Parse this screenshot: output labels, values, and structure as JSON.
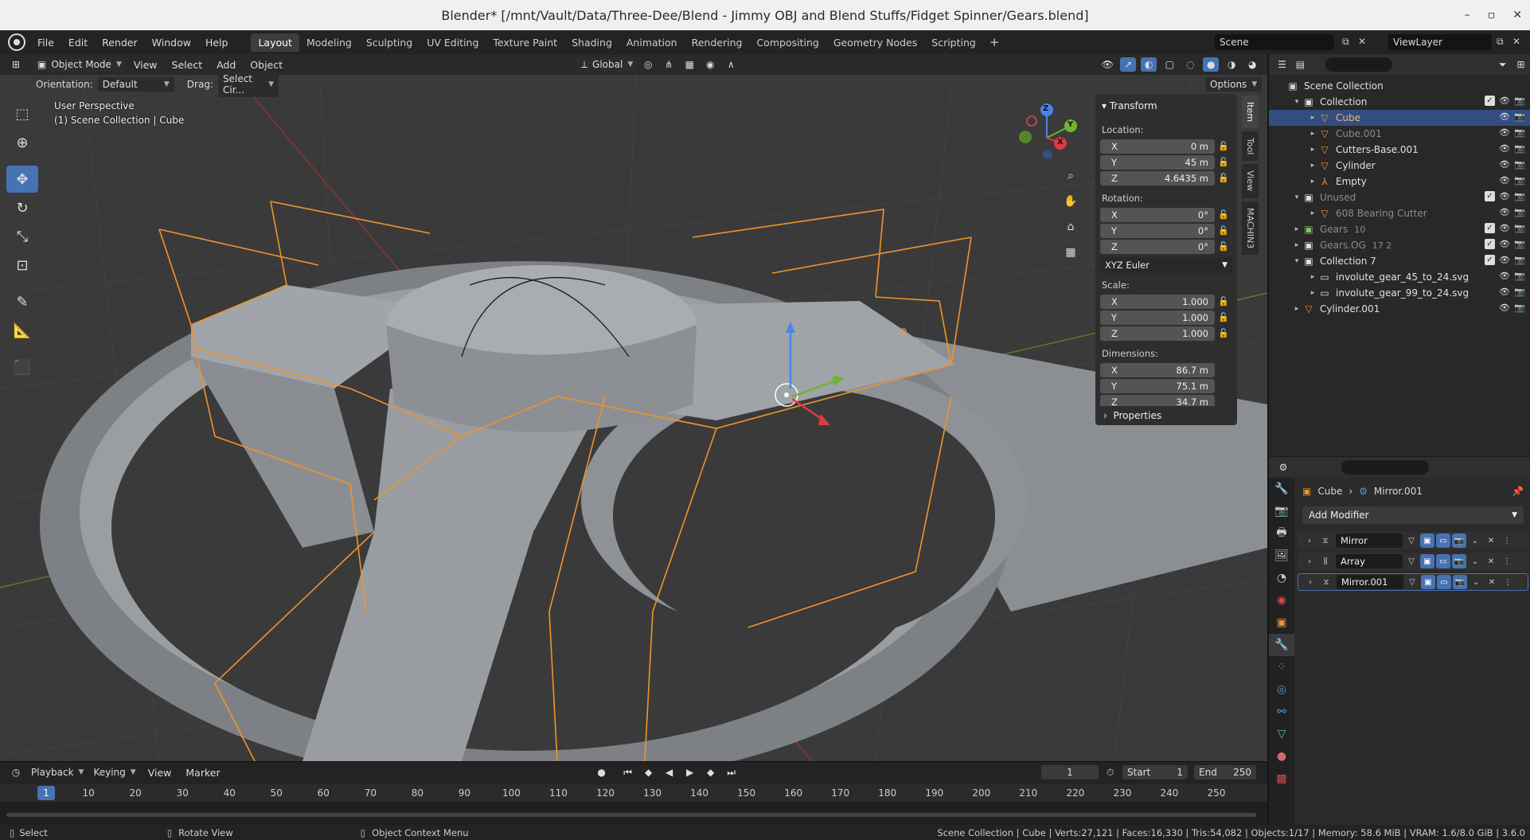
{
  "window": {
    "title": "Blender* [/mnt/Vault/Data/Three-Dee/Blend - Jimmy OBJ and Blend Stuffs/Fidget Spinner/Gears.blend]"
  },
  "menu": [
    "File",
    "Edit",
    "Render",
    "Window",
    "Help"
  ],
  "workspaces": [
    "Layout",
    "Modeling",
    "Sculpting",
    "UV Editing",
    "Texture Paint",
    "Shading",
    "Animation",
    "Rendering",
    "Compositing",
    "Geometry Nodes",
    "Scripting"
  ],
  "active_workspace": "Layout",
  "scene": "Scene",
  "view_layer": "ViewLayer",
  "viewport": {
    "mode": "Object Mode",
    "menus": [
      "View",
      "Select",
      "Add",
      "Object"
    ],
    "transform_orientation": "Global",
    "orientation_label": "Orientation:",
    "orientation_value": "Default",
    "drag_label": "Drag:",
    "drag_value": "Select Cir...",
    "options": "Options",
    "perspective": "User Perspective",
    "collection_info": "(1) Scene Collection | Cube"
  },
  "tools": [
    "select-box",
    "cursor",
    "move",
    "rotate",
    "scale",
    "transform",
    "annotate",
    "measure",
    "add-cube"
  ],
  "active_tool": "move",
  "gizmo": {
    "x": "X",
    "y": "Y",
    "z": "Z"
  },
  "npanel": {
    "title": "Transform",
    "location_label": "Location:",
    "location": {
      "x": "0 m",
      "y": "45 m",
      "z": "4.6435 m"
    },
    "rotation_label": "Rotation:",
    "rotation": {
      "x": "0°",
      "y": "0°",
      "z": "0°"
    },
    "rotation_mode": "XYZ Euler",
    "scale_label": "Scale:",
    "scale": {
      "x": "1.000",
      "y": "1.000",
      "z": "1.000"
    },
    "dimensions_label": "Dimensions:",
    "dimensions": {
      "x": "86.7 m",
      "y": "75.1 m",
      "z": "34.7 m"
    },
    "properties": "Properties",
    "axis_x": "X",
    "axis_y": "Y",
    "axis_z": "Z",
    "tabs": [
      "Item",
      "Tool",
      "View",
      "MACHIN3"
    ]
  },
  "timeline": {
    "menus": [
      "Playback",
      "Keying",
      "View",
      "Marker"
    ],
    "current_frame": "1",
    "start_label": "Start",
    "start": "1",
    "end_label": "End",
    "end": "250",
    "ticks": [
      "1",
      "10",
      "20",
      "30",
      "40",
      "50",
      "60",
      "70",
      "80",
      "90",
      "100",
      "110",
      "120",
      "130",
      "140",
      "150",
      "160",
      "170",
      "180",
      "190",
      "200",
      "210",
      "220",
      "230",
      "240",
      "250"
    ]
  },
  "statusbar": {
    "select": "Select",
    "rotate": "Rotate View",
    "context": "Object Context Menu",
    "stats": "Scene Collection | Cube | Verts:27,121 | Faces:16,330 | Tris:54,082 | Objects:1/17 | Memory: 58.6 MiB | VRAM: 1.6/8.0 GiB | 3.6.0"
  },
  "outliner": {
    "rows": [
      {
        "name": "Scene Collection",
        "depth": 0,
        "icon": "scene-collection",
        "exp": ""
      },
      {
        "name": "Collection",
        "depth": 1,
        "icon": "collection",
        "exp": "▾"
      },
      {
        "name": "Cube",
        "depth": 2,
        "icon": "mesh",
        "exp": "▸",
        "selected": true
      },
      {
        "name": "Cube.001",
        "depth": 2,
        "icon": "mesh",
        "exp": "▸",
        "dim": true
      },
      {
        "name": "Cutters-Base.001",
        "depth": 2,
        "icon": "mesh",
        "exp": "▸"
      },
      {
        "name": "Cylinder",
        "depth": 2,
        "icon": "mesh",
        "exp": "▸"
      },
      {
        "name": "Empty",
        "depth": 2,
        "icon": "empty",
        "exp": "▸"
      },
      {
        "name": "Unused",
        "depth": 1,
        "icon": "collection",
        "exp": "▾",
        "dim": true
      },
      {
        "name": "608 Bearing Cutter",
        "depth": 2,
        "icon": "mesh",
        "exp": "▸",
        "dim": true
      },
      {
        "name": "Gears",
        "depth": 1,
        "icon": "collection-green",
        "exp": "▸",
        "dim": true,
        "extra": "10"
      },
      {
        "name": "Gears.OG",
        "depth": 1,
        "icon": "collection",
        "exp": "▸",
        "dim": true,
        "extra": "17 2"
      },
      {
        "name": "Collection 7",
        "depth": 1,
        "icon": "collection",
        "exp": "▾"
      },
      {
        "name": "involute_gear_45_to_24.svg",
        "depth": 2,
        "icon": "curve",
        "exp": "▸"
      },
      {
        "name": "involute_gear_99_to_24.svg",
        "depth": 2,
        "icon": "curve",
        "exp": "▸"
      },
      {
        "name": "Cylinder.001",
        "depth": 1,
        "icon": "mesh",
        "exp": "▸"
      }
    ]
  },
  "properties": {
    "object": "Cube",
    "modifier": "Mirror.001",
    "add_modifier": "Add Modifier",
    "modifiers": [
      {
        "name": "Mirror",
        "active": false
      },
      {
        "name": "Array",
        "active": false
      },
      {
        "name": "Mirror.001",
        "active": true
      }
    ]
  },
  "colors": {
    "accent": "#4772b3",
    "selection": "#f0932b",
    "viewport_bg": "#3a3a3a"
  }
}
